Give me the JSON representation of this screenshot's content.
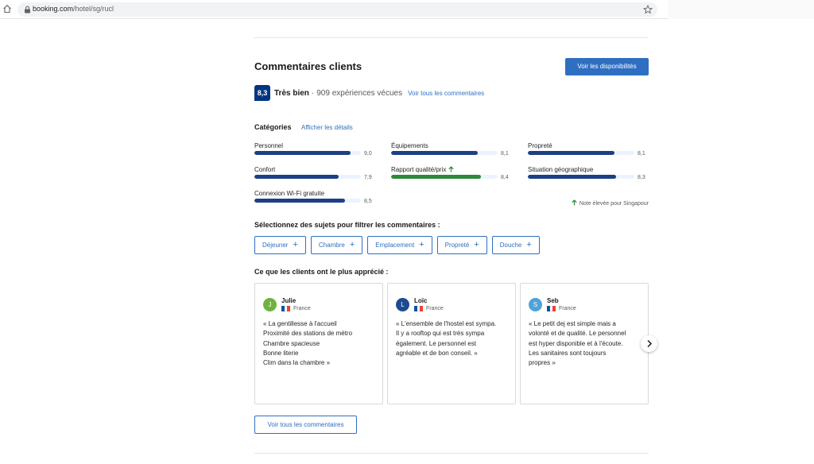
{
  "browser": {
    "url_host": "booking.com",
    "url_path": "/hotel/sg/rucl"
  },
  "reviews_section": {
    "title": "Commentaires clients",
    "availability_button": "Voir les disponibilités",
    "score": "8,3",
    "score_label": "Très bien",
    "separator": "·",
    "review_count": "909 expériences vécues",
    "see_all_link": "Voir tous les commentaires"
  },
  "categories": {
    "title": "Catégories",
    "details_link": "Afficher les détails",
    "items": [
      {
        "label": "Personnel",
        "score": "9,0",
        "fill_fraction": 0.9,
        "highlight": false
      },
      {
        "label": "Équipements",
        "score": "8,1",
        "fill_fraction": 0.81,
        "highlight": false
      },
      {
        "label": "Propreté",
        "score": "8,1",
        "fill_fraction": 0.81,
        "highlight": false
      },
      {
        "label": "Confort",
        "score": "7,9",
        "fill_fraction": 0.79,
        "highlight": false
      },
      {
        "label": "Rapport qualité/prix",
        "score": "8,4",
        "fill_fraction": 0.84,
        "highlight": true
      },
      {
        "label": "Situation géographique",
        "score": "8,3",
        "fill_fraction": 0.83,
        "highlight": false
      },
      {
        "label": "Connexion Wi-Fi gratuite",
        "score": "8,5",
        "fill_fraction": 0.85,
        "highlight": false
      }
    ],
    "high_note": "Note élevée pour Singapour"
  },
  "filters": {
    "title": "Sélectionnez des sujets pour filtrer les commentaires :",
    "chips": [
      "Déjeuner",
      "Chambre",
      "Emplacement",
      "Propreté",
      "Douche"
    ]
  },
  "highlights": {
    "title": "Ce que les clients ont le plus apprécié :",
    "reviews": [
      {
        "initial": "J",
        "name": "Julie",
        "country": "France",
        "avatar_color": "#6db33f",
        "text": "« La gentillesse à l'accueil\nProximité des stations de métro\nChambre spacieuse\nBonne literie\nClim dans la chambre »"
      },
      {
        "initial": "L",
        "name": "Loïc",
        "country": "France",
        "avatar_color": "#1d4b8f",
        "text": "« L'ensemble de l'hostel est sympa.\nIl y a rooftop qui est très sympa\négalement. Le personnel est\nagréable et de bon conseil.  »"
      },
      {
        "initial": "S",
        "name": "Seb",
        "country": "France",
        "avatar_color": "#4da3d9",
        "text": "« Le petit dej est simple mais a\nvolonté et de qualité. Le personnel\nest hyper disponible et à l'écoute.\nLes sanitaires sont toujours\npropres »"
      }
    ]
  },
  "footer": {
    "all_reviews_button": "Voir tous les commentaires"
  },
  "colors": {
    "brand_blue": "#003580",
    "link_blue": "#2f6fc2",
    "bar_blue": "#1d3f86",
    "bar_green": "#2c8a3a",
    "bar_track": "#ebf3ff"
  }
}
